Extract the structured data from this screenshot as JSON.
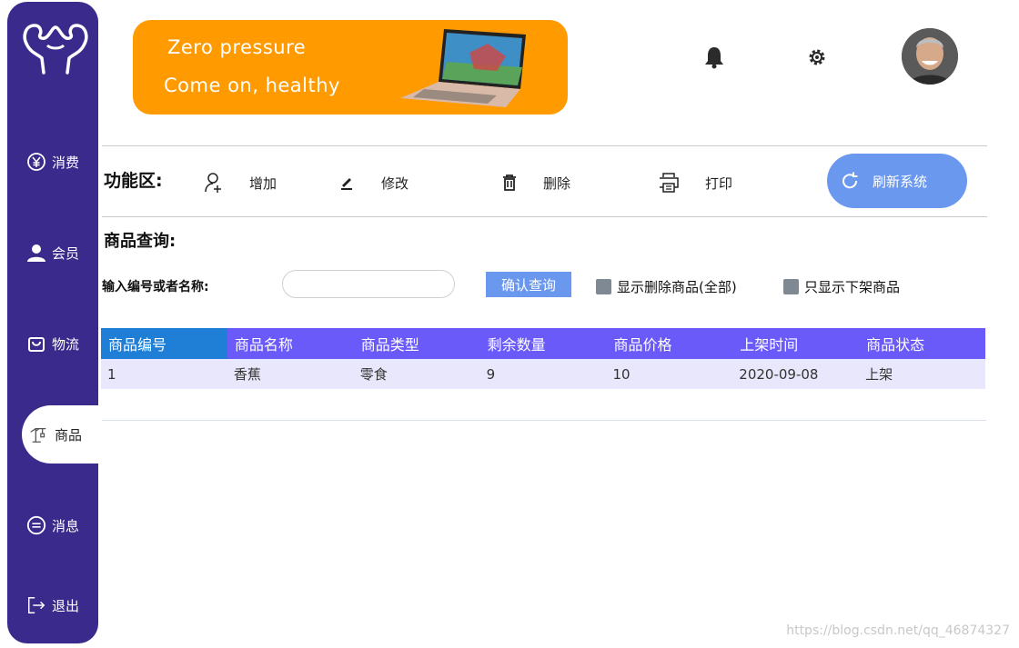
{
  "sidebar": {
    "items": [
      {
        "label": "消费",
        "icon": "yen-circle-icon"
      },
      {
        "label": "会员",
        "icon": "user-icon"
      },
      {
        "label": "物流",
        "icon": "bag-icon"
      },
      {
        "label": "商品",
        "icon": "crane-icon"
      },
      {
        "label": "消息",
        "icon": "message-icon"
      },
      {
        "label": "退出",
        "icon": "logout-icon"
      }
    ],
    "active": "商品",
    "color": "#3a2a8c"
  },
  "banner": {
    "line1": "Zero pressure",
    "line2": "Come on, healthy",
    "color": "#ff9a00"
  },
  "header": {
    "bell_icon": "bell-icon",
    "settings_icon": "gear-icon"
  },
  "toolbar": {
    "title": "功能区:",
    "add": "增加",
    "edit": "修改",
    "delete": "删除",
    "print": "打印",
    "refresh": "刷新系统"
  },
  "query": {
    "title": "商品查询:",
    "label": "输入编号或者名称:",
    "input_value": "",
    "button": "确认查询",
    "check_deleted": "显示删除商品(全部)",
    "check_offshelf": "只显示下架商品"
  },
  "table": {
    "columns": [
      "商品编号",
      "商品名称",
      "商品类型",
      "剩余数量",
      "商品价格",
      "上架时间",
      "商品状态"
    ],
    "rows": [
      [
        "1",
        "香蕉",
        "零食",
        "9",
        "10",
        "2020-09-08",
        "上架"
      ]
    ]
  },
  "watermark": "https://blog.csdn.net/qq_46874327"
}
